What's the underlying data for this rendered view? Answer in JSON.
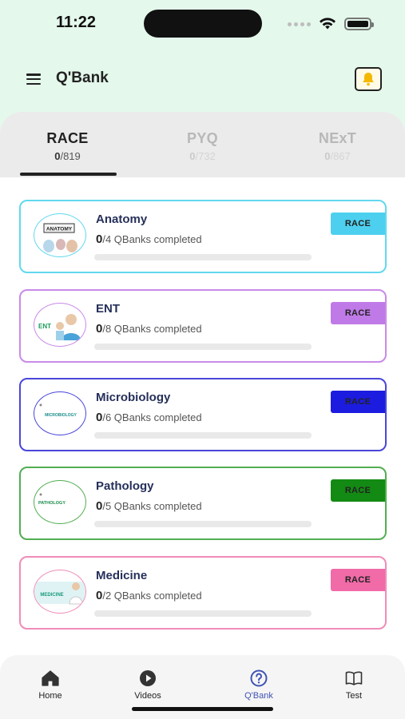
{
  "status_bar": {
    "time": "11:22"
  },
  "header": {
    "title": "Q'Bank",
    "menu_icon": "hamburger-menu-icon",
    "bell_icon": "bell-icon"
  },
  "tabs": [
    {
      "label": "RACE",
      "done": "0",
      "total": "/819",
      "active": true
    },
    {
      "label": "PYQ",
      "done": "0",
      "total": "/732",
      "active": false
    },
    {
      "label": "NExT",
      "done": "0",
      "total": "/867",
      "active": false
    }
  ],
  "subjects": [
    {
      "name": "Anatomy",
      "done": "0",
      "total": "/4",
      "suffix": " QBanks completed",
      "badge": "RACE",
      "color": "#62d8ef",
      "badge_color": "#4dd0ef",
      "logo_text": "ANATOMY",
      "progress": 0
    },
    {
      "name": "ENT",
      "done": "0",
      "total": "/8",
      "suffix": " QBanks completed",
      "badge": "RACE",
      "color": "#c98ae8",
      "badge_color": "#c07ae8",
      "logo_text": "ENT",
      "progress": 0
    },
    {
      "name": "Microbiology",
      "done": "0",
      "total": "/6",
      "suffix": " QBanks completed",
      "badge": "RACE",
      "color": "#4a46d9",
      "badge_color": "#1c1ce0",
      "logo_text": "MICROBIOLOGY",
      "progress": 0
    },
    {
      "name": "Pathology",
      "done": "0",
      "total": "/5",
      "suffix": " QBanks completed",
      "badge": "RACE",
      "color": "#52ae52",
      "badge_color": "#138a13",
      "logo_text": "PATHOLOGY",
      "progress": 0
    },
    {
      "name": "Medicine",
      "done": "0",
      "total": "/2",
      "suffix": " QBanks completed",
      "badge": "RACE",
      "color": "#f08cb8",
      "badge_color": "#f06ba8",
      "logo_text": "MEDICINE",
      "progress": 0
    }
  ],
  "bottom_nav": [
    {
      "label": "Home",
      "icon": "home-icon",
      "active": false
    },
    {
      "label": "Videos",
      "icon": "play-circle-icon",
      "active": false
    },
    {
      "label": "Q'Bank",
      "icon": "question-circle-icon",
      "active": true
    },
    {
      "label": "Test",
      "icon": "book-icon",
      "active": false
    }
  ]
}
